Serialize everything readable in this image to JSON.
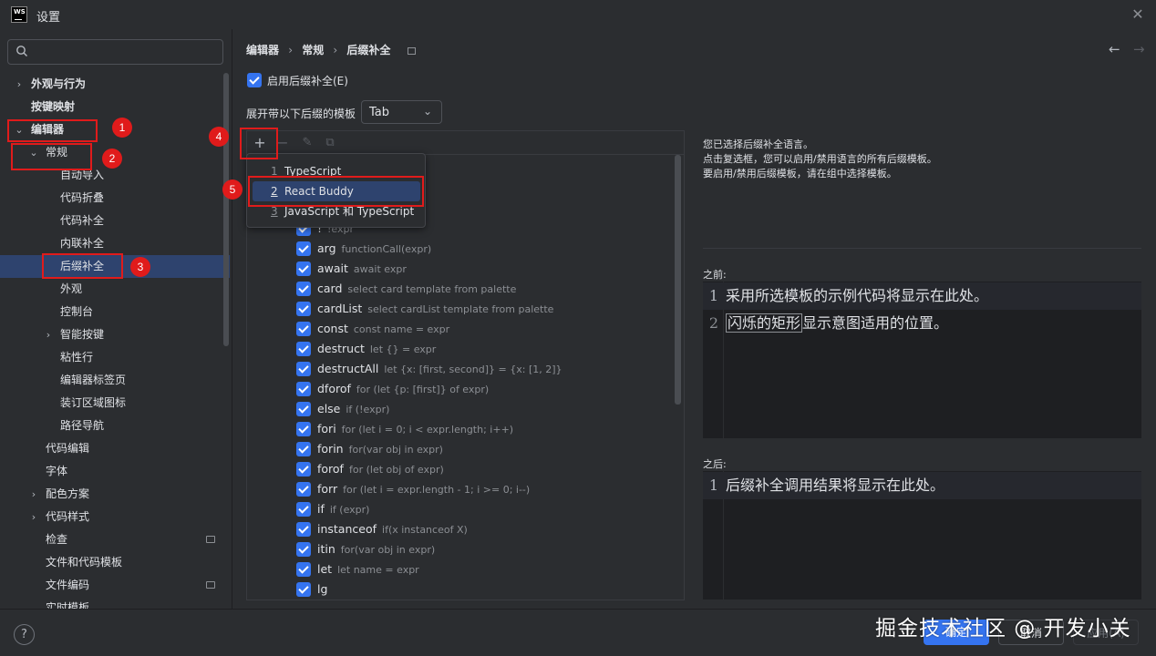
{
  "window": {
    "title": "设置"
  },
  "search": {
    "placeholder": ""
  },
  "sidebar": {
    "items": [
      {
        "label": "外观与行为",
        "chevron": "›"
      },
      {
        "label": "按键映射"
      },
      {
        "label": "编辑器",
        "chevron": "⌄"
      },
      {
        "label": "常规",
        "chevron": "⌄"
      },
      {
        "label": "自动导入"
      },
      {
        "label": "代码折叠"
      },
      {
        "label": "代码补全"
      },
      {
        "label": "内联补全"
      },
      {
        "label": "后缀补全"
      },
      {
        "label": "外观"
      },
      {
        "label": "控制台"
      },
      {
        "label": "智能按键",
        "chevron": "›"
      },
      {
        "label": "粘性行"
      },
      {
        "label": "编辑器标签页"
      },
      {
        "label": "装订区域图标"
      },
      {
        "label": "路径导航"
      },
      {
        "label": "代码编辑"
      },
      {
        "label": "字体"
      },
      {
        "label": "配色方案",
        "chevron": "›"
      },
      {
        "label": "代码样式",
        "chevron": "›"
      },
      {
        "label": "检查"
      },
      {
        "label": "文件和代码模板"
      },
      {
        "label": "文件编码"
      },
      {
        "label": "实时模板"
      }
    ]
  },
  "breadcrumb": {
    "part1": "编辑器",
    "sep": "›",
    "part2": "常规",
    "part3": "后缀补全"
  },
  "settings": {
    "enable_label": "启用后缀补全(E)",
    "expand_label": "展开带以下后缀的模板",
    "expand_value": "Tab"
  },
  "toolbar": {
    "add": "+",
    "remove": "−",
    "edit": "✎",
    "copy": "⧉"
  },
  "popup": {
    "items": [
      {
        "num": "1",
        "label": "TypeScript"
      },
      {
        "num": "2",
        "label": "React Buddy"
      },
      {
        "num": "3",
        "label": "JavaScript 和 TypeScript"
      }
    ]
  },
  "templates": [
    {
      "key": "!",
      "desc": "!expr"
    },
    {
      "key": "arg",
      "desc": "functionCall(expr)"
    },
    {
      "key": "await",
      "desc": "await expr"
    },
    {
      "key": "card",
      "desc": "select card template from palette"
    },
    {
      "key": "cardList",
      "desc": "select cardList template from palette"
    },
    {
      "key": "const",
      "desc": "const name = expr"
    },
    {
      "key": "destruct",
      "desc": "let {} = expr"
    },
    {
      "key": "destructAll",
      "desc": "let {x: [first, second]} = {x: [1, 2]}"
    },
    {
      "key": "dforof",
      "desc": "for (let {p: [first]} of expr)"
    },
    {
      "key": "else",
      "desc": "if (!expr)"
    },
    {
      "key": "fori",
      "desc": "for (let i = 0; i < expr.length; i++)"
    },
    {
      "key": "forin",
      "desc": "for(var obj in expr)"
    },
    {
      "key": "forof",
      "desc": "for (let obj of expr)"
    },
    {
      "key": "forr",
      "desc": "for (let i = expr.length - 1; i >= 0; i--)"
    },
    {
      "key": "if",
      "desc": "if (expr)"
    },
    {
      "key": "instanceof",
      "desc": "if(x instanceof X)"
    },
    {
      "key": "itin",
      "desc": "for(var obj in expr)"
    },
    {
      "key": "let",
      "desc": "let name = expr"
    },
    {
      "key": "lg",
      "desc": ""
    }
  ],
  "info": {
    "line1": "您已选择后缀补全语言。",
    "line2": "点击复选框，您可以启用/禁用语言的所有后缀模板。",
    "line3": "要启用/禁用后缀模板，请在组中选择模板。"
  },
  "before": {
    "label": "之前:",
    "line1_num": "1",
    "line1": "采用所选模板的示例代码将显示在此处。",
    "line2_num": "2",
    "line2_boxed": "闪烁的矩形",
    "line2_rest": "显示意图适用的位置。"
  },
  "after": {
    "label": "之后:",
    "line1_num": "1",
    "line1": "后缀补全调用结果将显示在此处。"
  },
  "buttons": {
    "ok": "确定",
    "cancel": "取消",
    "apply": "应用(A)"
  },
  "annotations": [
    "1",
    "2",
    "3",
    "4",
    "5"
  ],
  "watermark": "掘金技术社区 @ 开发小关",
  "colors": {
    "accent": "#3574f0",
    "selection": "#2e436e",
    "annotation_red": "#e01b1b"
  }
}
